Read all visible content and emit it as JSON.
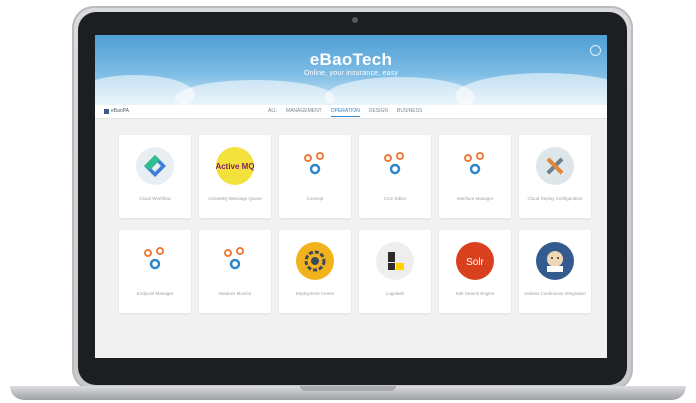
{
  "header": {
    "logo_text": "eBaoTech",
    "tagline": "Online, your insurance, easy"
  },
  "nav": {
    "home_label": "eBaoPA",
    "tabs": [
      {
        "label": "ALL",
        "active": false
      },
      {
        "label": "MANAGEMENT",
        "active": false
      },
      {
        "label": "OPERATION",
        "active": true
      },
      {
        "label": "DESIGN",
        "active": false
      },
      {
        "label": "BUSINESS",
        "active": false
      }
    ]
  },
  "tiles": [
    {
      "label": "Cloud Workflow",
      "icon": "cloud-workflow-icon",
      "color": "#3d7dd8"
    },
    {
      "label": "ActiveMQ Message Queue",
      "icon": "activemq-icon",
      "color": "#7d1f6a",
      "icon_text": "Active MQ"
    },
    {
      "label": "Concept",
      "icon": "gears-icon",
      "color": "#f07c3b"
    },
    {
      "label": "Cron Editor",
      "icon": "gears-icon",
      "color": "#f07c3b"
    },
    {
      "label": "Interface Manager",
      "icon": "gears-icon",
      "color": "#f07c3b"
    },
    {
      "label": "Cloud Deploy Configuration",
      "icon": "tools-icon",
      "color": "#6d7f8c"
    },
    {
      "label": "Endpoint Manager",
      "icon": "gears-icon",
      "color": "#f07c3b"
    },
    {
      "label": "Instance Monitor",
      "icon": "gears-icon",
      "color": "#f07c3b"
    },
    {
      "label": "Deployment Center",
      "icon": "deployment-icon",
      "color": "#f2b21b"
    },
    {
      "label": "Logstash",
      "icon": "logstash-icon",
      "color": "#2c2c2c"
    },
    {
      "label": "Solr Search Engine",
      "icon": "solr-icon",
      "color": "#d9411e",
      "icon_text": "Solr"
    },
    {
      "label": "Jenkins Continuous Integration",
      "icon": "jenkins-icon",
      "color": "#335b8f"
    }
  ]
}
